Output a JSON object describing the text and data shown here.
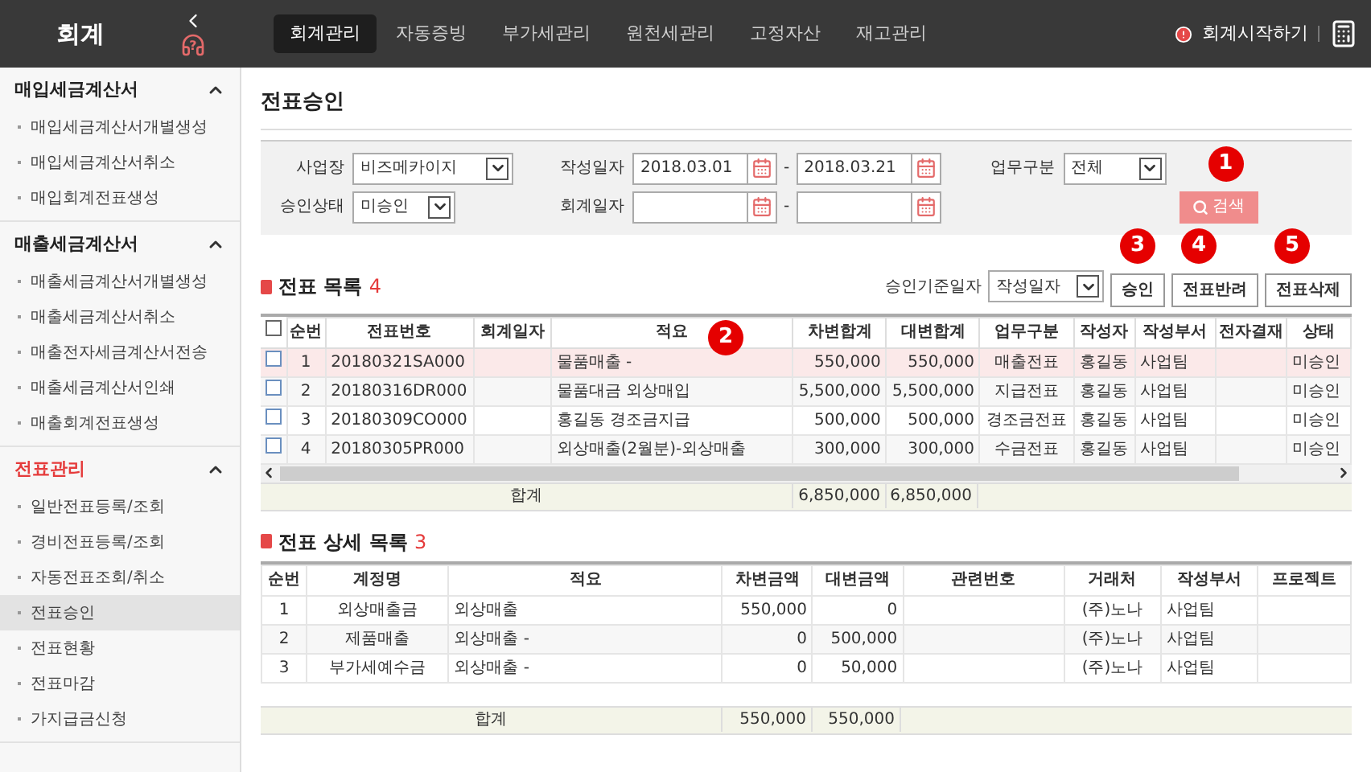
{
  "app": {
    "title": "회계",
    "help_badge": "?"
  },
  "nav": [
    {
      "label": "회계관리",
      "selected": true
    },
    {
      "label": "자동증빙",
      "selected": false
    },
    {
      "label": "부가세관리",
      "selected": false
    },
    {
      "label": "원천세관리",
      "selected": false
    },
    {
      "label": "고정자산",
      "selected": false
    },
    {
      "label": "재고관리",
      "selected": false
    }
  ],
  "header_link": "회계시작하기",
  "sidebar": [
    {
      "title": "매입세금계산서",
      "active": false,
      "expanded": true,
      "items": [
        {
          "label": "매입세금계산서개별생성",
          "selected": false
        },
        {
          "label": "매입세금계산서취소",
          "selected": false
        },
        {
          "label": "매입회계전표생성",
          "selected": false
        }
      ]
    },
    {
      "title": "매출세금계산서",
      "active": false,
      "expanded": true,
      "items": [
        {
          "label": "매출세금계산서개별생성",
          "selected": false
        },
        {
          "label": "매출세금계산서취소",
          "selected": false
        },
        {
          "label": "매출전자세금계산서전송",
          "selected": false
        },
        {
          "label": "매출세금계산서인쇄",
          "selected": false
        },
        {
          "label": "매출회계전표생성",
          "selected": false
        }
      ]
    },
    {
      "title": "전표관리",
      "active": true,
      "expanded": true,
      "items": [
        {
          "label": "일반전표등록/조회",
          "selected": false
        },
        {
          "label": "경비전표등록/조회",
          "selected": false
        },
        {
          "label": "자동전표조회/취소",
          "selected": false
        },
        {
          "label": "전표승인",
          "selected": true
        },
        {
          "label": "전표현황",
          "selected": false
        },
        {
          "label": "전표마감",
          "selected": false
        },
        {
          "label": "가지급금신청",
          "selected": false
        }
      ]
    }
  ],
  "page_title": "전표승인",
  "search": {
    "site_label": "사업장",
    "site": "비즈메카이지",
    "status_label": "승인상태",
    "status": "미승인",
    "written_label": "작성일자",
    "written_from": "2018.03.01",
    "written_to": "2018.03.21",
    "account_label": "회계일자",
    "range_sep": "-",
    "type_label": "업무구분",
    "type": "전체",
    "search_button": "검색",
    "search_callout": "1"
  },
  "approve_date_label": "승인기준일자",
  "approve_date": "작성일자",
  "actions": [
    {
      "label": "승인",
      "callout": "3"
    },
    {
      "label": "전표반려",
      "callout": "4"
    },
    {
      "label": "전표삭제",
      "callout": "5"
    }
  ],
  "vouchers": {
    "title": "전표 목록",
    "count": "4",
    "callout": "2",
    "all_checked": false,
    "columns": [
      "순번",
      "전표번호",
      "회계일자",
      "적요",
      "차변합계",
      "대변합계",
      "업무구분",
      "작성자",
      "작성부서",
      "전자결재",
      "상태"
    ],
    "rows": [
      {
        "checked": false,
        "selected": true,
        "cells": [
          "1",
          "20180321SA000",
          "",
          "물품매출 -",
          "550,000",
          "550,000",
          "매출전표",
          "홍길동",
          "사업팀",
          "",
          "미승인"
        ]
      },
      {
        "checked": false,
        "selected": false,
        "cells": [
          "2",
          "20180316DR000",
          "",
          "물품대금 외상매입",
          "5,500,000",
          "5,500,000",
          "지급전표",
          "홍길동",
          "사업팀",
          "",
          "미승인"
        ]
      },
      {
        "checked": false,
        "selected": false,
        "cells": [
          "3",
          "20180309CO000",
          "",
          "홍길동 경조금지급",
          "500,000",
          "500,000",
          "경조금전표",
          "홍길동",
          "사업팀",
          "",
          "미승인"
        ]
      },
      {
        "checked": false,
        "selected": false,
        "cells": [
          "4",
          "20180305PR000",
          "",
          "외상매출(2월분)-외상매출",
          "300,000",
          "300,000",
          "수금전표",
          "홍길동",
          "사업팀",
          "",
          "미승인"
        ]
      }
    ],
    "total_label": "합계",
    "total_debit": "6,850,000",
    "total_credit": "6,850,000"
  },
  "details": {
    "title": "전표 상세 목록",
    "count": "3",
    "columns": [
      "순번",
      "계정명",
      "적요",
      "차변금액",
      "대변금액",
      "관련번호",
      "거래처",
      "작성부서",
      "프로젝트"
    ],
    "rows": [
      [
        "1",
        "외상매출금",
        "외상매출",
        "550,000",
        "0",
        "",
        "(주)노나",
        "사업팀",
        ""
      ],
      [
        "2",
        "제품매출",
        "외상매출 -",
        "0",
        "500,000",
        "",
        "(주)노나",
        "사업팀",
        ""
      ],
      [
        "3",
        "부가세예수금",
        "외상매출 -",
        "0",
        "50,000",
        "",
        "(주)노나",
        "사업팀",
        ""
      ]
    ],
    "total_label": "합계",
    "total_debit": "550,000",
    "total_credit": "550,000"
  }
}
